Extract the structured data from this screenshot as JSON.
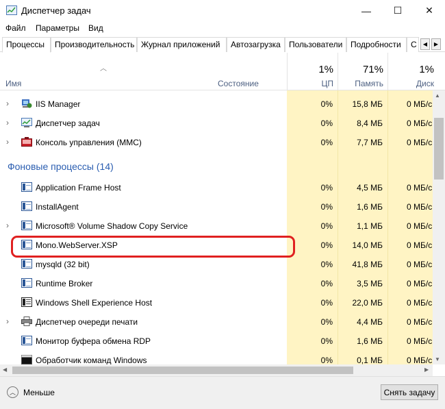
{
  "window": {
    "title": "Диспетчер задач",
    "controls": {
      "minimize": "—",
      "maximize": "☐",
      "close": "✕"
    }
  },
  "menu": [
    "Файл",
    "Параметры",
    "Вид"
  ],
  "tabs": [
    "Процессы",
    "Производительность",
    "Журнал приложений",
    "Автозагрузка",
    "Пользователи",
    "Подробности",
    "С"
  ],
  "active_tab": "Процессы",
  "columns": {
    "name": "Имя",
    "state": "Состояние",
    "cpu": {
      "percent": "1%",
      "label": "ЦП"
    },
    "memory": {
      "percent": "71%",
      "label": "Память"
    },
    "disk": {
      "percent": "1%",
      "label": "Диск"
    }
  },
  "apps": [
    {
      "name": "IIS Manager",
      "cpu": "0%",
      "mem": "15,8 МБ",
      "disk": "0 МБ/с",
      "icon": "iis-manager-icon",
      "expandable": true
    },
    {
      "name": "Диспетчер задач",
      "cpu": "0%",
      "mem": "8,4 МБ",
      "disk": "0 МБ/с",
      "icon": "task-manager-icon",
      "expandable": true
    },
    {
      "name": "Консоль управления (MMC)",
      "cpu": "0%",
      "mem": "7,7 МБ",
      "disk": "0 МБ/с",
      "icon": "mmc-icon",
      "expandable": true
    }
  ],
  "background_section": {
    "title": "Фоновые процессы (14)"
  },
  "background": [
    {
      "name": "Application Frame Host",
      "cpu": "0%",
      "mem": "4,5 МБ",
      "disk": "0 МБ/с",
      "expandable": false
    },
    {
      "name": "InstallAgent",
      "cpu": "0%",
      "mem": "1,6 МБ",
      "disk": "0 МБ/с",
      "expandable": false
    },
    {
      "name": "Microsoft® Volume Shadow Copy Service",
      "cpu": "0%",
      "mem": "1,1 МБ",
      "disk": "0 МБ/с",
      "expandable": true
    },
    {
      "name": "Mono.WebServer.XSP",
      "cpu": "0%",
      "mem": "14,0 МБ",
      "disk": "0 МБ/с",
      "expandable": false
    },
    {
      "name": "mysqld (32 bit)",
      "cpu": "0%",
      "mem": "41,8 МБ",
      "disk": "0 МБ/с",
      "expandable": false
    },
    {
      "name": "Runtime Broker",
      "cpu": "0%",
      "mem": "3,5 МБ",
      "disk": "0 МБ/с",
      "expandable": false
    },
    {
      "name": "Windows Shell Experience Host",
      "cpu": "0%",
      "mem": "22,0 МБ",
      "disk": "0 МБ/с",
      "expandable": false
    },
    {
      "name": "Диспетчер очереди печати",
      "cpu": "0%",
      "mem": "4,4 МБ",
      "disk": "0 МБ/с",
      "expandable": true
    },
    {
      "name": "Монитор буфера обмена RDP",
      "cpu": "0%",
      "mem": "1,6 МБ",
      "disk": "0 МБ/с",
      "expandable": false
    },
    {
      "name": "Обработчик команд Windows",
      "cpu": "0%",
      "mem": "0,1 МБ",
      "disk": "0 МБ/с",
      "expandable": false
    }
  ],
  "footer": {
    "less_label": "Меньше",
    "end_task_label": "Снять задачу"
  }
}
